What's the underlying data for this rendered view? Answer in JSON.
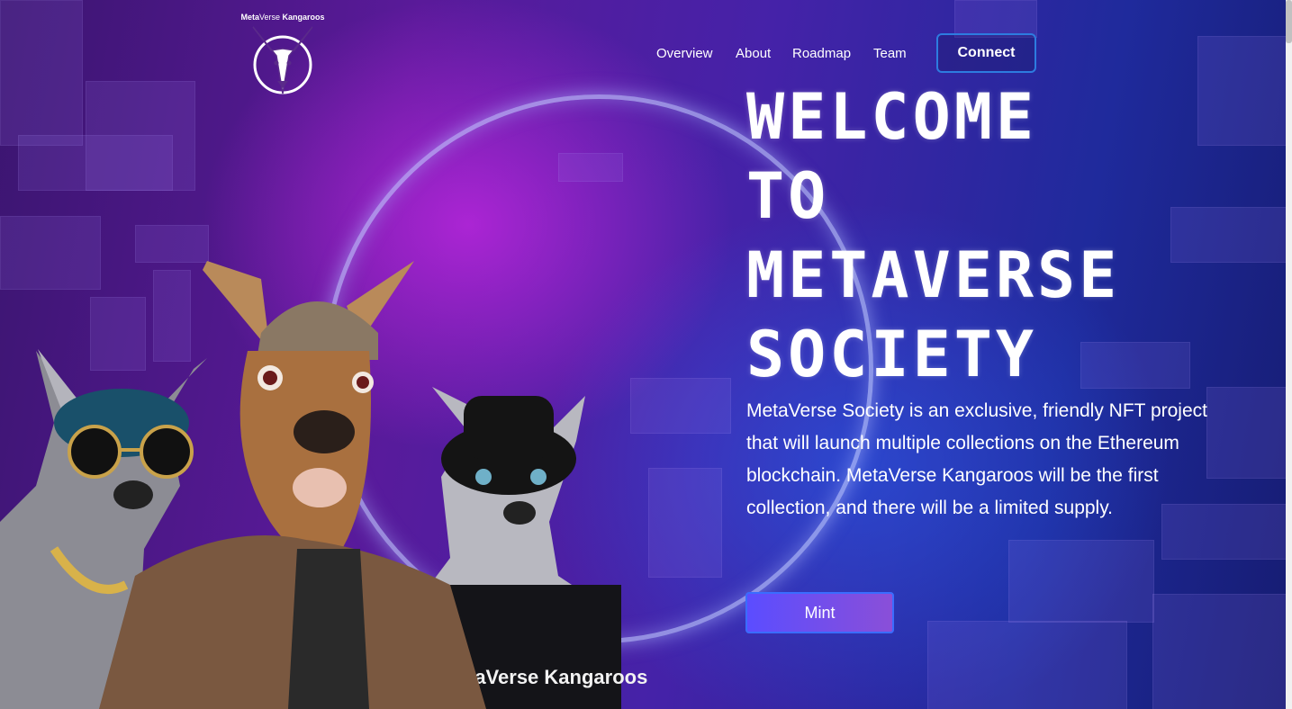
{
  "logo": {
    "brand_bold": "Meta",
    "brand_thin": "Verse",
    "brand_tail": " Kangaroos",
    "icon": "kangaroo-head-icon"
  },
  "nav": {
    "items": [
      "Overview",
      "About",
      "Roadmap",
      "Team"
    ],
    "connect_label": "Connect"
  },
  "hero": {
    "title_lines": [
      "WELCOME",
      "TO",
      "METAVERSE",
      "SOCIETY"
    ],
    "description": "MetaVerse Society is an exclusive, friendly NFT project that will launch multiple collections on the Ethereum blockchain. MetaVerse Kangaroos will be the first collection, and there will be a limited supply.",
    "mint_label": "Mint",
    "shirt_print": "taVerse Kangaroos"
  },
  "colors": {
    "accent_border": "#2d7ce0",
    "mint_gradient_start": "#5b4dff",
    "mint_gradient_end": "#8a4fd8",
    "glow_ring": "#c8ccff"
  }
}
